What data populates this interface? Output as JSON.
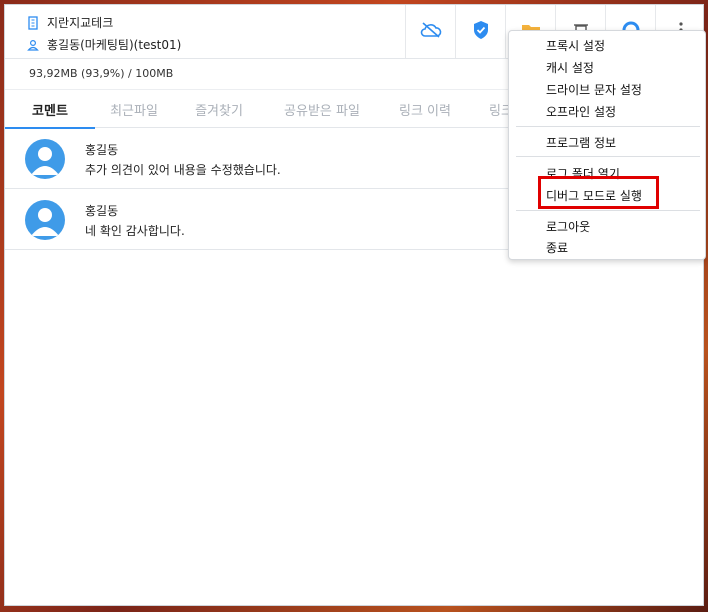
{
  "header": {
    "company": "지란지교테크",
    "user": "홍길동(마케팅팀)(test01)"
  },
  "storage": {
    "usage": "93,92MB (93,9%) / 100MB"
  },
  "tabs": [
    {
      "label": "코멘트",
      "active": true
    },
    {
      "label": "최근파일"
    },
    {
      "label": "즐겨찾기"
    },
    {
      "label": "공유받은 파일"
    },
    {
      "label": "링크 이력"
    },
    {
      "label": "링크"
    }
  ],
  "comments": [
    {
      "name": "홍길동",
      "text": "추가 의견이 있어 내용을 수정했습니다."
    },
    {
      "name": "홍길동",
      "text": "네 확인 감사합니다."
    }
  ],
  "menu": {
    "items": [
      "프록시 설정",
      "캐시 설정",
      "드라이브 문자 설정",
      "오프라인 설정",
      "프로그램 정보",
      "로그 폴더 열기",
      "디버그 모드로 실행",
      "로그아웃",
      "종료"
    ]
  },
  "colors": {
    "accent": "#2d8cf0",
    "highlight": "#e00000",
    "avatar": "#3f9be8"
  }
}
